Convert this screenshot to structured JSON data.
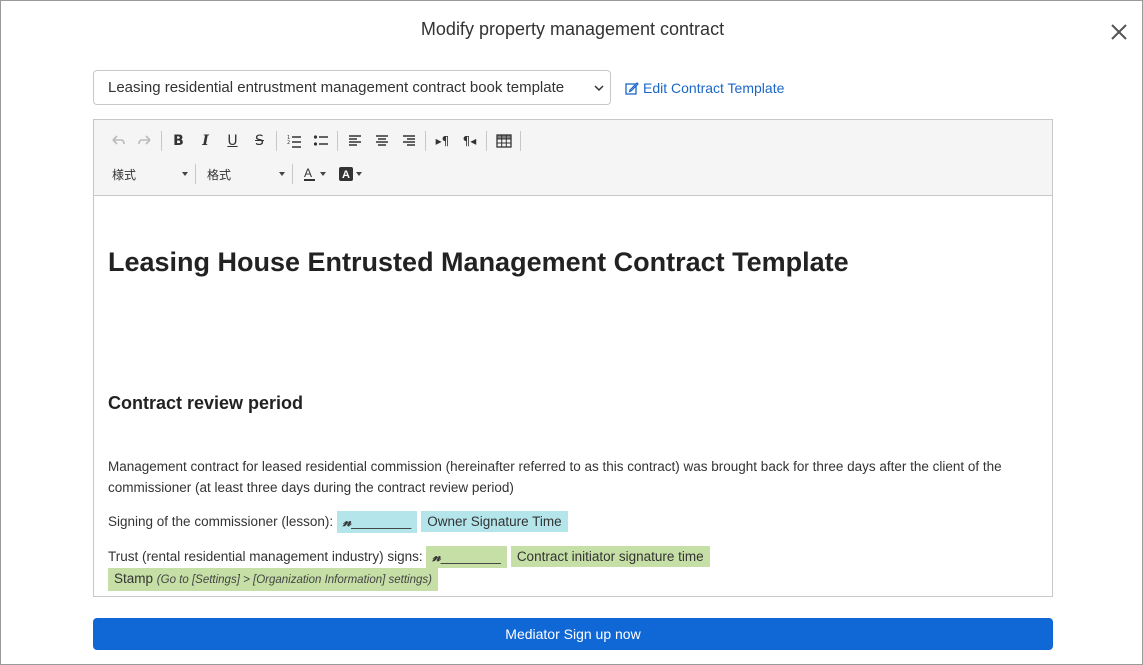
{
  "modal": {
    "title": "Modify property management contract",
    "close_label": "×"
  },
  "template_select": {
    "selected": "Leasing residential entrustment management contract book template"
  },
  "edit_link": {
    "label": "Edit Contract Template"
  },
  "toolbar": {
    "style_dropdown": "様式",
    "format_dropdown": "格式",
    "buttons": [
      "undo",
      "redo",
      "bold",
      "italic",
      "underline",
      "strikethrough",
      "numbered-list",
      "bulleted-list",
      "align-left",
      "align-center",
      "align-right",
      "ltr",
      "rtl",
      "table",
      "text-color",
      "background-color"
    ]
  },
  "document": {
    "title": "Leasing House Entrusted Management Contract Template",
    "section_heading": "Contract review period",
    "paragraph1": "Management contract for leased residential commission (hereinafter referred to as this contract) was brought back for three days after the client of the commissioner (at least three days during the contract review period)",
    "paragraph2_label": "Signing of the commissioner (lesson):",
    "owner_signature_blank": "________",
    "owner_signature_time": "Owner Signature Time",
    "paragraph3_label": "Trust (rental residential management industry) signs:",
    "initiator_signature_blank": "________",
    "initiator_signature_time": "Contract initiator signature time",
    "stamp_label": "Stamp",
    "stamp_note": "(Go to [Settings] > [Organization Information] settings)"
  },
  "footer": {
    "mediator_button": "Mediator Sign up now"
  },
  "colors": {
    "primary": "#1067d6",
    "link": "#1a67c8",
    "chip_blue": "#b3e5ea",
    "chip_green": "#c5dfa6"
  }
}
